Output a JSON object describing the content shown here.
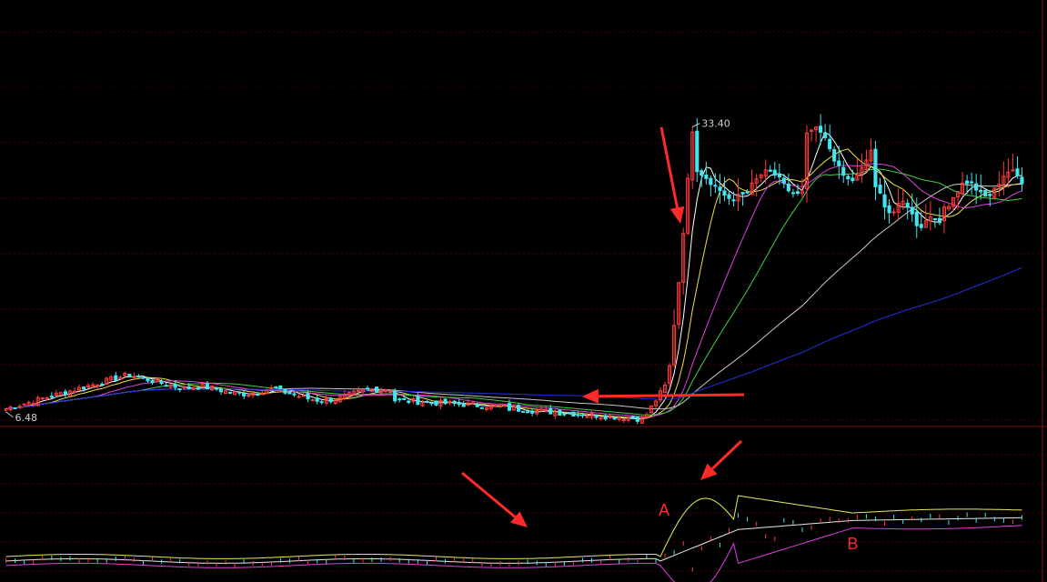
{
  "chart_data": {
    "type": "candlestick",
    "grid": true,
    "colors": {
      "background": "#000000",
      "grid": "#4a0000",
      "up": "#ff3b3b",
      "down": "#42e6f0",
      "ma_short": "#ffffff",
      "ma_yellow": "#f0e040",
      "ma_magenta": "#e040e0",
      "ma_green": "#40d040",
      "ma_gray": "#c8c8c8",
      "ma_blue": "#2030e0",
      "band_upper": "#e8e860",
      "band_mid": "#e8e8e8",
      "band_lower": "#e040e0",
      "annotation": "#ff2a2a"
    },
    "price_panel": {
      "ylim": [
        5.8,
        36.0
      ],
      "max_label": "33.40",
      "min_label": "6.48",
      "max_index": 150,
      "min_index": 0
    },
    "indicator_panel": {
      "ylim": [
        -1.0,
        1.0
      ]
    },
    "candles": [],
    "annotations": [
      {
        "label": "A",
        "index": 143
      },
      {
        "label": "B",
        "index": 185
      }
    ]
  }
}
